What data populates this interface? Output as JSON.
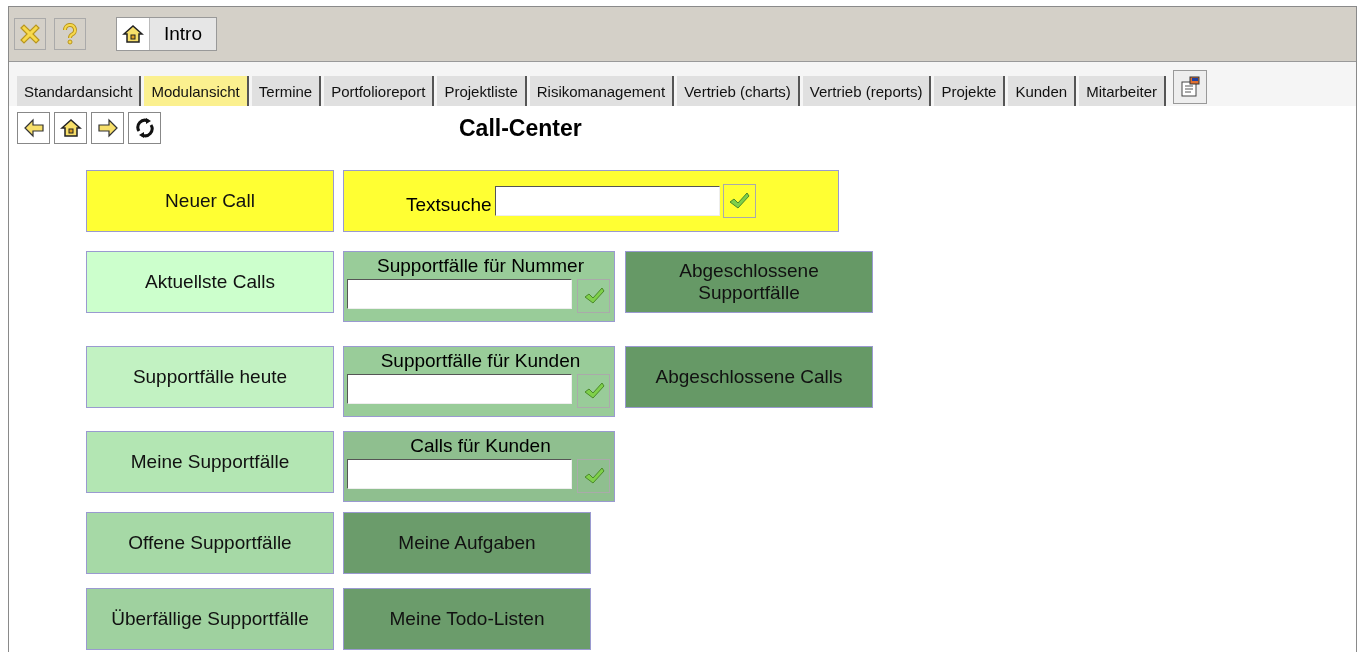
{
  "toolbar": {
    "intro_button": "Intro"
  },
  "tabs": [
    {
      "label": "Standardansicht",
      "selected": false
    },
    {
      "label": "Modulansicht",
      "selected": true
    },
    {
      "label": "Termine",
      "selected": false
    },
    {
      "label": "Portfolioreport",
      "selected": false
    },
    {
      "label": "Projektliste",
      "selected": false
    },
    {
      "label": "Risikomanagement",
      "selected": false
    },
    {
      "label": "Vertrieb (charts)",
      "selected": false
    },
    {
      "label": "Vertrieb (reports)",
      "selected": false
    },
    {
      "label": "Projekte",
      "selected": false
    },
    {
      "label": "Kunden",
      "selected": false
    },
    {
      "label": "Mitarbeiter",
      "selected": false
    }
  ],
  "page_title": "Call-Center",
  "rows": [
    [
      {
        "kind": "button",
        "label": "Neuer Call",
        "color": "#ffff33"
      },
      {
        "kind": "search",
        "label": "Textsuche",
        "color": "#ffff33"
      }
    ],
    [
      {
        "kind": "button",
        "label": "Aktuellste Calls",
        "color": "#ccffcc"
      },
      {
        "kind": "panel",
        "label": "Supportfälle für Nummer",
        "color": "#99cc99"
      },
      {
        "kind": "button",
        "label": "Abgeschlossene Supportfälle",
        "color": "#669966"
      }
    ],
    [
      {
        "kind": "button",
        "label": "Supportfälle heute",
        "color": "#c2f2c2"
      },
      {
        "kind": "panel",
        "label": "Supportfälle für Kunden",
        "color": "#99cc99"
      },
      {
        "kind": "button",
        "label": "Abgeschlossene Calls",
        "color": "#669966"
      }
    ],
    [
      {
        "kind": "button",
        "label": "Meine Supportfälle",
        "color": "#b3e6b3"
      },
      {
        "kind": "panel",
        "label": "Calls für Kunden",
        "color": "#8fbf8f"
      }
    ],
    [
      {
        "kind": "button",
        "label": "Offene Supportfälle",
        "color": "#a6d9a6"
      },
      {
        "kind": "button",
        "label": "Meine Aufgaben",
        "color": "#6b9c6b"
      }
    ],
    [
      {
        "kind": "button",
        "label": "Überfällige Supportfälle",
        "color": "#9fd19f"
      },
      {
        "kind": "button",
        "label": "Meine Todo-Listen",
        "color": "#6b9c6b"
      }
    ]
  ]
}
